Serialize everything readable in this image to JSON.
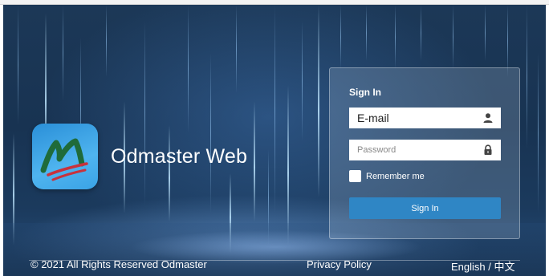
{
  "brand": {
    "name": "Odmaster Web",
    "logo_icon": "odmaster-logo-icon",
    "colors": {
      "tile": "#3aa3e6",
      "mark_green": "#1f6b3a",
      "mark_red": "#c8323c"
    }
  },
  "signin_panel": {
    "title": "Sign In",
    "email": {
      "value": "E-mail",
      "icon": "user-icon"
    },
    "password": {
      "placeholder": "Password",
      "icon": "lock-icon"
    },
    "remember_label": "Remember me",
    "remember_checked": false,
    "submit_label": "Sign In",
    "accent": "#2f86c5"
  },
  "footer": {
    "copyright": "© 2021 All Rights Reserved Odmaster",
    "privacy_label": "Privacy Policy",
    "language_label": "English / 中文"
  }
}
